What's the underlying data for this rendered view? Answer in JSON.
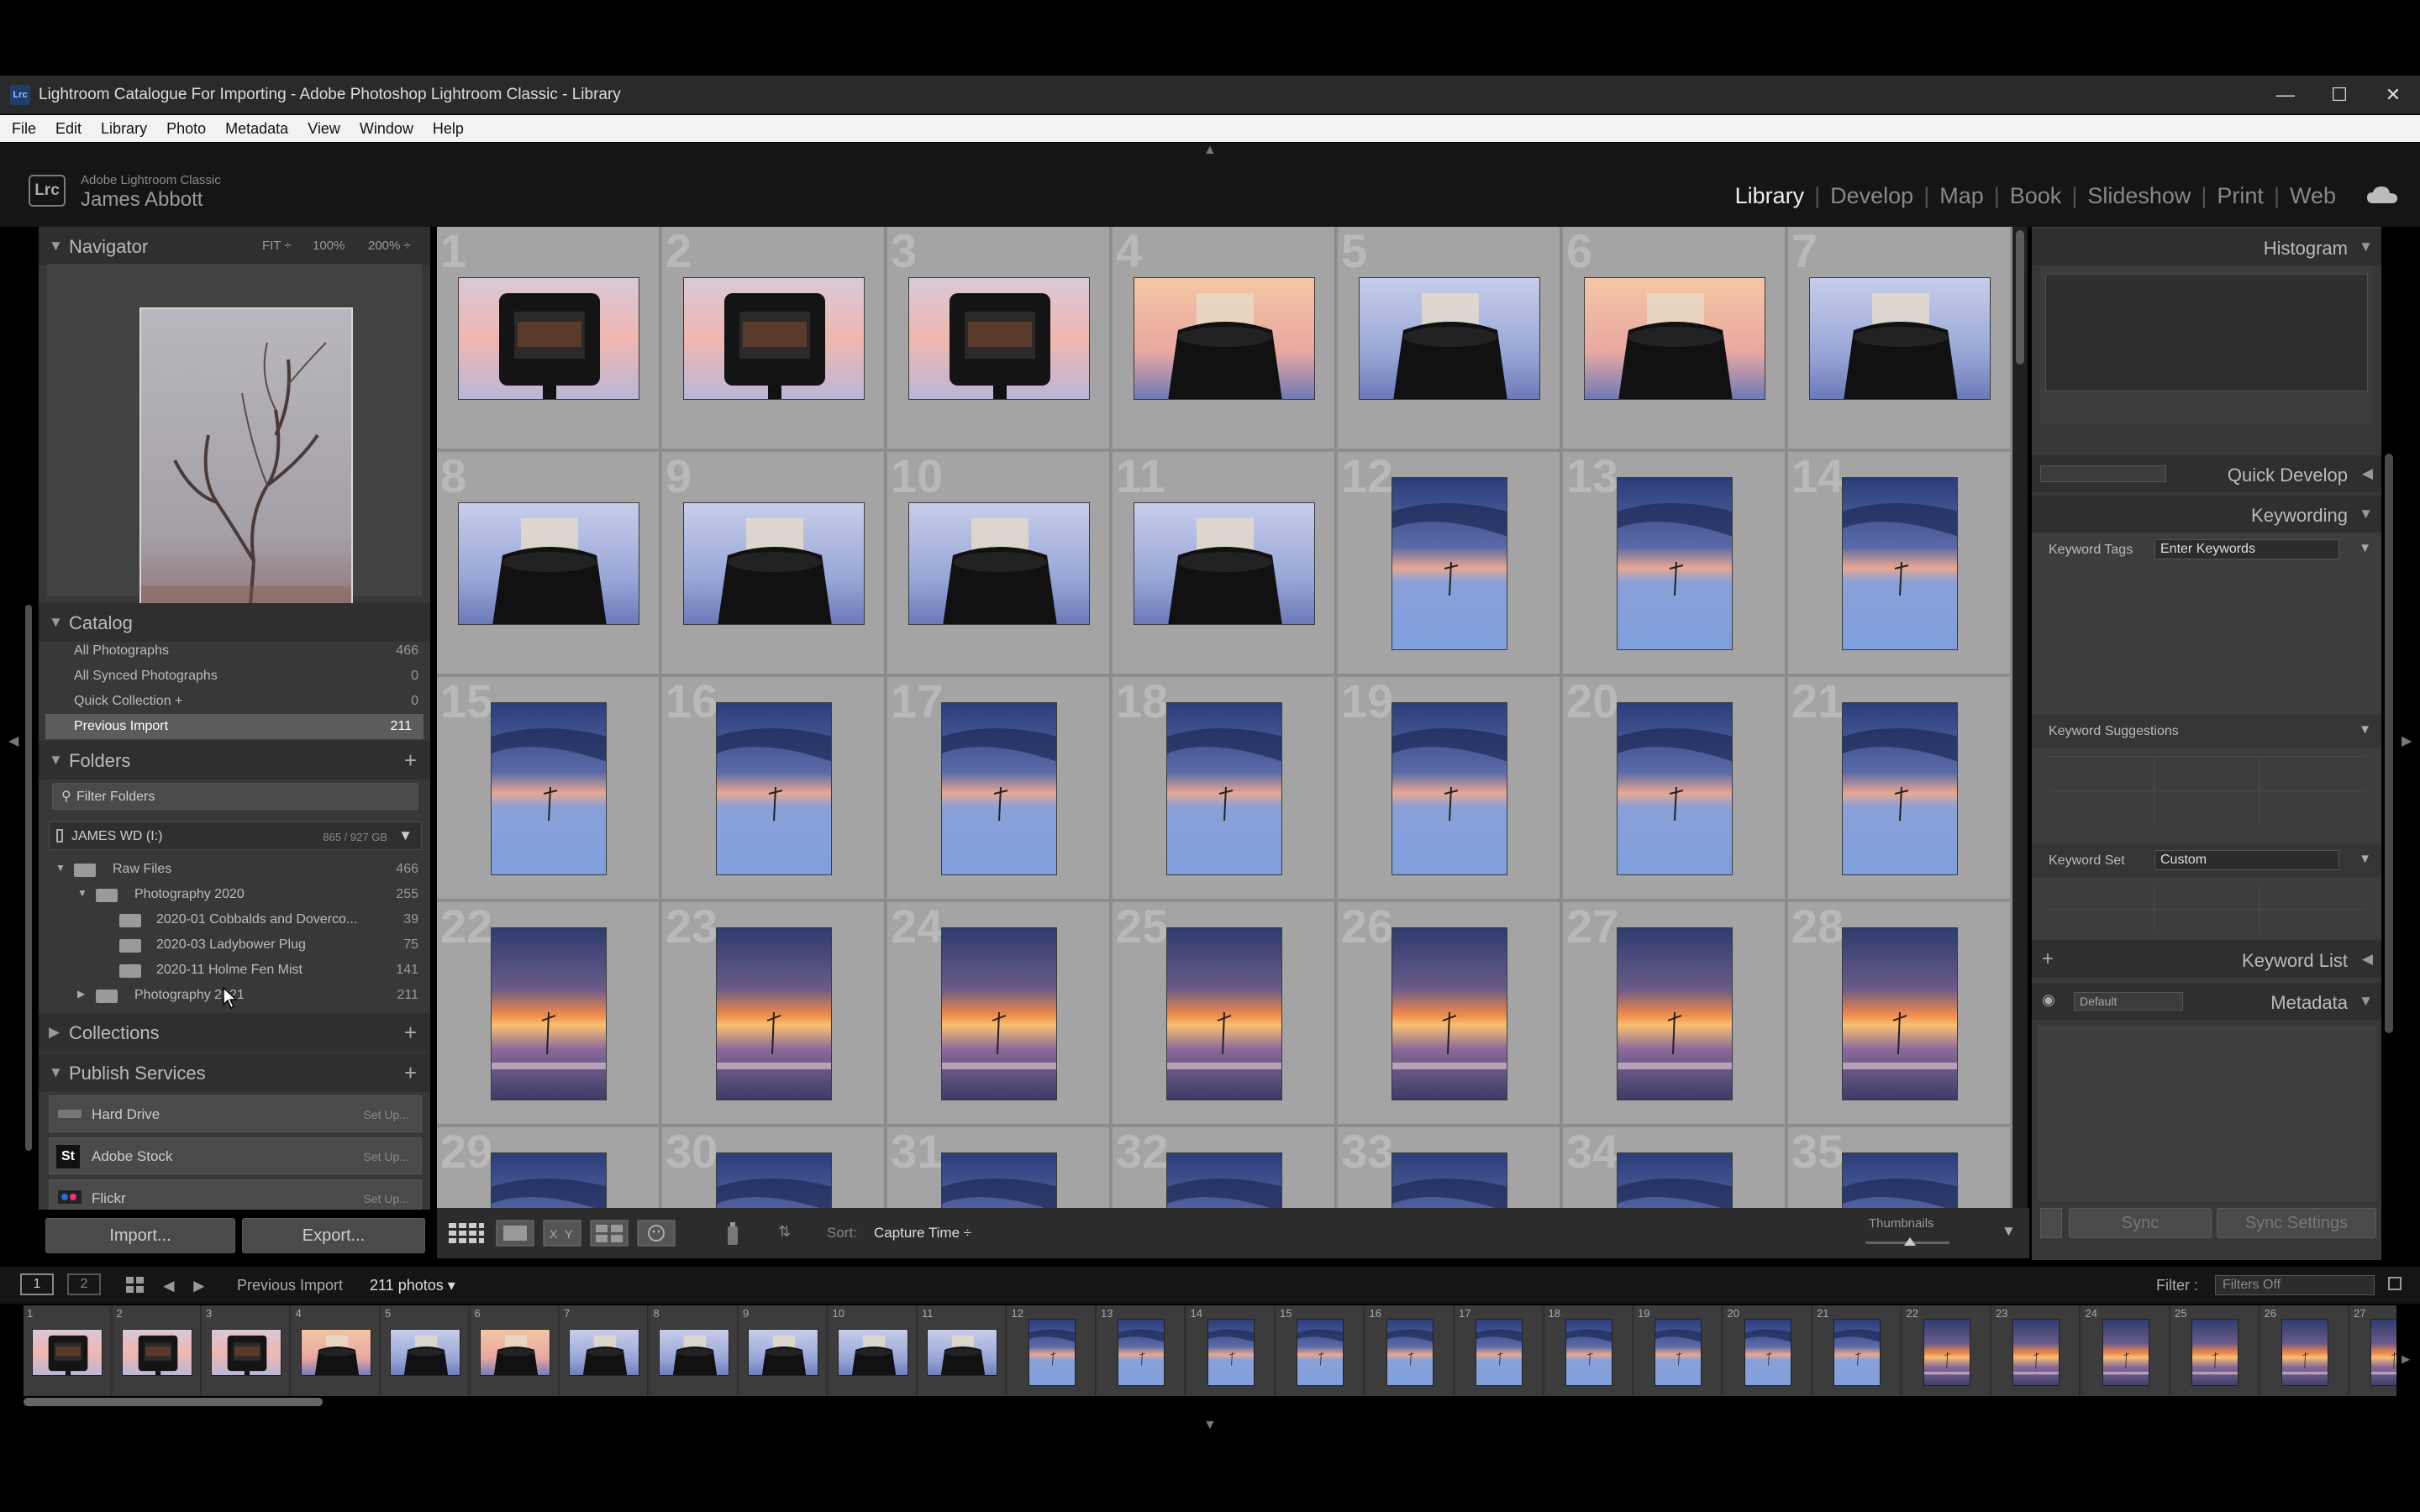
{
  "window": {
    "title": "Lightroom Catalogue For Importing - Adobe Photoshop Lightroom Classic - Library",
    "app_badge": "Lrc",
    "controls": [
      "—",
      "☐",
      "✕"
    ]
  },
  "menu": [
    "File",
    "Edit",
    "Library",
    "Photo",
    "Metadata",
    "View",
    "Window",
    "Help"
  ],
  "identity": {
    "badge": "Lrc",
    "product": "Adobe Lightroom Classic",
    "user": "James Abbott"
  },
  "modules": [
    "Library",
    "Develop",
    "Map",
    "Book",
    "Slideshow",
    "Print",
    "Web"
  ],
  "active_module": "Library",
  "navigator": {
    "title": "Navigator",
    "zoom_options": [
      "FIT ÷",
      "100%",
      "200% ÷"
    ]
  },
  "catalog": {
    "title": "Catalog",
    "items": [
      {
        "label": "All Photographs",
        "count": "466"
      },
      {
        "label": "All Synced Photographs",
        "count": "0"
      },
      {
        "label": "Quick Collection +",
        "count": "0"
      },
      {
        "label": "Previous Import",
        "count": "211"
      }
    ],
    "selected_index": 3
  },
  "folders": {
    "title": "Folders",
    "filter_placeholder": "Filter Folders",
    "volume": {
      "name": "JAMES WD (I:)",
      "space": "865 / 927 GB"
    },
    "items": [
      {
        "label": "Raw Files",
        "count": "466",
        "expander": "▼"
      },
      {
        "label": "Photography 2020",
        "count": "255",
        "expander": "▼"
      },
      {
        "label": "2020-01 Cobbalds and Doverco...",
        "count": "39",
        "expander": ""
      },
      {
        "label": "2020-03 Ladybower Plug",
        "count": "75",
        "expander": ""
      },
      {
        "label": "2020-11 Holme Fen Mist",
        "count": "141",
        "expander": ""
      },
      {
        "label": "Photography 2021",
        "count": "211",
        "expander": "▶"
      }
    ]
  },
  "collections": {
    "title": "Collections"
  },
  "publish": {
    "title": "Publish Services",
    "items": [
      {
        "label": "Hard Drive",
        "action": "Set Up...",
        "icon": "hard-drive-icon"
      },
      {
        "label": "Adobe Stock",
        "action": "Set Up...",
        "icon": "adobe-stock-icon",
        "badge": "St"
      },
      {
        "label": "Flickr",
        "action": "Set Up...",
        "icon": "flickr-icon"
      }
    ]
  },
  "buttons": {
    "import": "Import...",
    "export": "Export..."
  },
  "grid": {
    "cells": [
      {
        "n": "1",
        "kind": "camera"
      },
      {
        "n": "2",
        "kind": "camera"
      },
      {
        "n": "3",
        "kind": "camera"
      },
      {
        "n": "4",
        "kind": "filter"
      },
      {
        "n": "5",
        "kind": "filter-blue"
      },
      {
        "n": "6",
        "kind": "filter"
      },
      {
        "n": "7",
        "kind": "filter-blue"
      },
      {
        "n": "8",
        "kind": "filter-blue"
      },
      {
        "n": "9",
        "kind": "filter-blue"
      },
      {
        "n": "10",
        "kind": "filter-blue"
      },
      {
        "n": "11",
        "kind": "filter-blue"
      },
      {
        "n": "12",
        "kind": "blue"
      },
      {
        "n": "13",
        "kind": "blue"
      },
      {
        "n": "14",
        "kind": "blue"
      },
      {
        "n": "15",
        "kind": "blue"
      },
      {
        "n": "16",
        "kind": "blue"
      },
      {
        "n": "17",
        "kind": "blue"
      },
      {
        "n": "18",
        "kind": "blue"
      },
      {
        "n": "19",
        "kind": "blue"
      },
      {
        "n": "20",
        "kind": "blue"
      },
      {
        "n": "21",
        "kind": "blue"
      },
      {
        "n": "22",
        "kind": "sunset"
      },
      {
        "n": "23",
        "kind": "sunset"
      },
      {
        "n": "24",
        "kind": "sunset"
      },
      {
        "n": "25",
        "kind": "sunset"
      },
      {
        "n": "26",
        "kind": "sunset"
      },
      {
        "n": "27",
        "kind": "sunset"
      },
      {
        "n": "28",
        "kind": "sunset"
      },
      {
        "n": "29",
        "kind": "blue"
      },
      {
        "n": "30",
        "kind": "blue"
      },
      {
        "n": "31",
        "kind": "blue"
      },
      {
        "n": "32",
        "kind": "blue"
      },
      {
        "n": "33",
        "kind": "blue"
      },
      {
        "n": "34",
        "kind": "blue"
      },
      {
        "n": "35",
        "kind": "blue"
      }
    ]
  },
  "toolbar": {
    "sort_label": "Sort:",
    "sort_value": "Capture Time ÷",
    "thumbnails_label": "Thumbnails"
  },
  "right": {
    "histogram": "Histogram",
    "quick_develop": "Quick Develop",
    "keywording": "Keywording",
    "keyword_tags_label": "Keyword Tags",
    "keyword_tags_value": "Enter Keywords",
    "keyword_suggestions": "Keyword Suggestions",
    "keyword_set_label": "Keyword Set",
    "keyword_set_value": "Custom",
    "keyword_list": "Keyword List",
    "metadata": "Metadata",
    "metadata_preset": "Default",
    "sync": "Sync",
    "sync_settings": "Sync Settings"
  },
  "filmbar": {
    "screen1": "1",
    "screen2": "2",
    "source": "Previous Import",
    "count": "211 photos ▾",
    "filter_label": "Filter :",
    "filter_value": "Filters Off"
  },
  "filmstrip": [
    {
      "n": "1",
      "kind": "camera"
    },
    {
      "n": "2",
      "kind": "camera"
    },
    {
      "n": "3",
      "kind": "camera"
    },
    {
      "n": "4",
      "kind": "filter"
    },
    {
      "n": "5",
      "kind": "filter-blue"
    },
    {
      "n": "6",
      "kind": "filter"
    },
    {
      "n": "7",
      "kind": "filter-blue"
    },
    {
      "n": "8",
      "kind": "filter-blue"
    },
    {
      "n": "9",
      "kind": "filter-blue"
    },
    {
      "n": "10",
      "kind": "filter-blue"
    },
    {
      "n": "11",
      "kind": "filter-blue"
    },
    {
      "n": "12",
      "kind": "blue"
    },
    {
      "n": "13",
      "kind": "blue"
    },
    {
      "n": "14",
      "kind": "blue"
    },
    {
      "n": "15",
      "kind": "blue"
    },
    {
      "n": "16",
      "kind": "blue"
    },
    {
      "n": "17",
      "kind": "blue"
    },
    {
      "n": "18",
      "kind": "blue"
    },
    {
      "n": "19",
      "kind": "blue"
    },
    {
      "n": "20",
      "kind": "blue"
    },
    {
      "n": "21",
      "kind": "blue"
    },
    {
      "n": "22",
      "kind": "sunset"
    },
    {
      "n": "23",
      "kind": "sunset"
    },
    {
      "n": "24",
      "kind": "sunset"
    },
    {
      "n": "25",
      "kind": "sunset"
    },
    {
      "n": "26",
      "kind": "sunset"
    },
    {
      "n": "27",
      "kind": "sunset"
    }
  ]
}
